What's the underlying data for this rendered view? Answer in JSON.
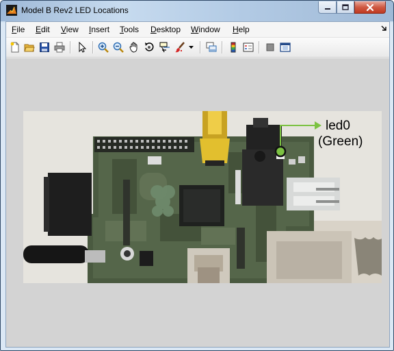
{
  "window": {
    "title": "Model B Rev2 LED Locations",
    "icon": "matlab-figure-icon"
  },
  "menubar": {
    "items": [
      "File",
      "Edit",
      "View",
      "Insert",
      "Tools",
      "Desktop",
      "Window",
      "Help"
    ],
    "dock_icon": "dock-arrow-icon"
  },
  "toolbar": {
    "buttons": [
      "new-figure-icon",
      "open-file-icon",
      "save-icon",
      "print-icon",
      "edit-plot-icon",
      "zoom-in-icon",
      "zoom-out-icon",
      "pan-icon",
      "rotate-3d-icon",
      "data-cursor-icon",
      "brush-icon",
      "brush-dropdown-icon",
      "link-plot-icon",
      "insert-colorbar-icon",
      "insert-legend-icon",
      "hide-plot-tools-icon",
      "show-plot-tools-icon"
    ]
  },
  "figure": {
    "image": "raspberry-pi-model-b-board-photo",
    "annotation": {
      "line1": "led0",
      "line2": "(Green)",
      "arrow_color": "#7cc242",
      "marker_color": "#7cc242"
    }
  }
}
